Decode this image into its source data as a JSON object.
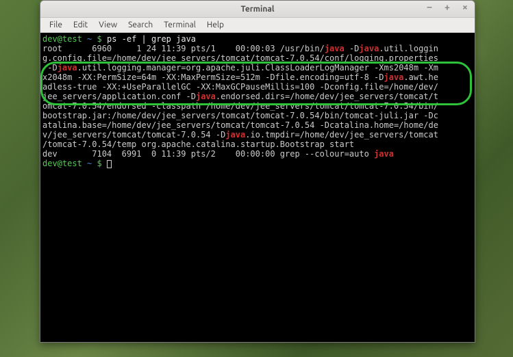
{
  "window": {
    "title": "Terminal"
  },
  "menubar": {
    "file": "File",
    "edit": "Edit",
    "view": "View",
    "search": "Search",
    "terminal": "Terminal",
    "help": "Help"
  },
  "prompt": {
    "user_host": "dev@test",
    "path": "~",
    "symbol": "$"
  },
  "command": "ps -ef | grep java",
  "output": {
    "line1_a": "root      6960     1 24 11:39 pts/1    00:00:03 /usr/bin/",
    "line1_b": " -D",
    "line1_c": ".util.loggin",
    "line2": "g.config.file=/home/dev/jee_servers/tomcat/tomcat-7.0.54/conf/logging.properties",
    "line3_a": " -D",
    "line3_b": ".util.logging.manager=org.apache.juli.ClassLoaderLogManager -Xms2048m -Xm",
    "line4_a": "x2048m -XX:PermSize=64m -XX:MaxPermSize=512m -Dfile.encoding=utf-8 -D",
    "line4_b": ".awt.he",
    "line5": "adless-true -XX:+UseParallelGC -XX:MaxGCPauseMillis=100 -Dconfig.file=/home/dev/",
    "line6_a": "jee_servers/application.conf -D",
    "line6_b": ".endorsed.dirs=/home/dev/jee_servers/tomcat/t",
    "line7": "omcat-7.0.54/endorsed -classpath /home/dev/jee_servers/tomcat/tomcat-7.0.54/bin/",
    "line8": "bootstrap.jar:/home/dev/jee_servers/tomcat/tomcat-7.0.54/bin/tomcat-juli.jar -Dc",
    "line9": "atalina.base=/home/dev/jee_servers/tomcat/tomcat-7.0.54 -Dcatalina.home=/home/de",
    "line10_a": "v/jee_servers/tomcat/tomcat-7.0.54 -D",
    "line10_b": ".io.tmpdir=/home/dev/jee_servers/tomcat",
    "line11": "/tomcat-7.0.54/temp org.apache.catalina.startup.Bootstrap start",
    "line12_a": "dev       7104  6991  0 11:39 pts/2    00:00:00 grep --colour=auto ",
    "java": "java"
  }
}
